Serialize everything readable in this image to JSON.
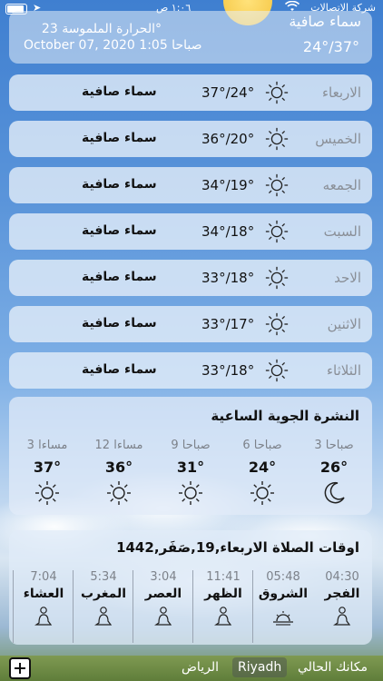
{
  "status_bar": {
    "carrier": "شركة الاتصالات",
    "time": "١:٠٦ ص"
  },
  "header": {
    "condition": "سماء صافية",
    "feels_like": "الحرارة الملموسة 23°",
    "date": "October 07, 2020  صباحا 1:05",
    "range": "24°/37°"
  },
  "days": [
    {
      "name": "الاربعاء",
      "temp": "37°/24°",
      "desc": "سماء صافية"
    },
    {
      "name": "الخميس",
      "temp": "36°/20°",
      "desc": "سماء صافية"
    },
    {
      "name": "الجمعه",
      "temp": "34°/19°",
      "desc": "سماء صافية"
    },
    {
      "name": "السبت",
      "temp": "34°/18°",
      "desc": "سماء صافية"
    },
    {
      "name": "الاحد",
      "temp": "33°/18°",
      "desc": "سماء صافية"
    },
    {
      "name": "الاثنين",
      "temp": "33°/17°",
      "desc": "سماء صافية"
    },
    {
      "name": "الثلاثاء",
      "temp": "33°/18°",
      "desc": "سماء صافية"
    }
  ],
  "hourly": {
    "title": "النشرة الجوية الساعية",
    "items": [
      {
        "time": "3 صباحا",
        "temp": "26°",
        "icon": "moon-icon"
      },
      {
        "time": "6 صباحا",
        "temp": "24°",
        "icon": "sun-icon"
      },
      {
        "time": "9 صباحا",
        "temp": "31°",
        "icon": "sun-icon"
      },
      {
        "time": "12 مساءا",
        "temp": "36°",
        "icon": "sun-icon"
      },
      {
        "time": "3 مساءا",
        "temp": "37°",
        "icon": "sun-icon"
      }
    ]
  },
  "prayer": {
    "title": "اوقات الصلاة  الاربعاء,19,صَفَر,1442",
    "items": [
      {
        "name": "الفجر",
        "time": "04:30",
        "icon": "praying-person-icon"
      },
      {
        "name": "الشروق",
        "time": "05:48",
        "icon": "sunrise-icon"
      },
      {
        "name": "الظهر",
        "time": "11:41",
        "icon": "praying-person-icon"
      },
      {
        "name": "العصر",
        "time": "3:04",
        "icon": "praying-person-icon"
      },
      {
        "name": "المغرب",
        "time": "5:34",
        "icon": "praying-person-icon"
      },
      {
        "name": "العشاء",
        "time": "7:04",
        "icon": "praying-person-icon"
      }
    ]
  },
  "bottom_bar": {
    "tabs": [
      "مكانك الحالي",
      "Riyadh",
      "الرياض"
    ]
  }
}
